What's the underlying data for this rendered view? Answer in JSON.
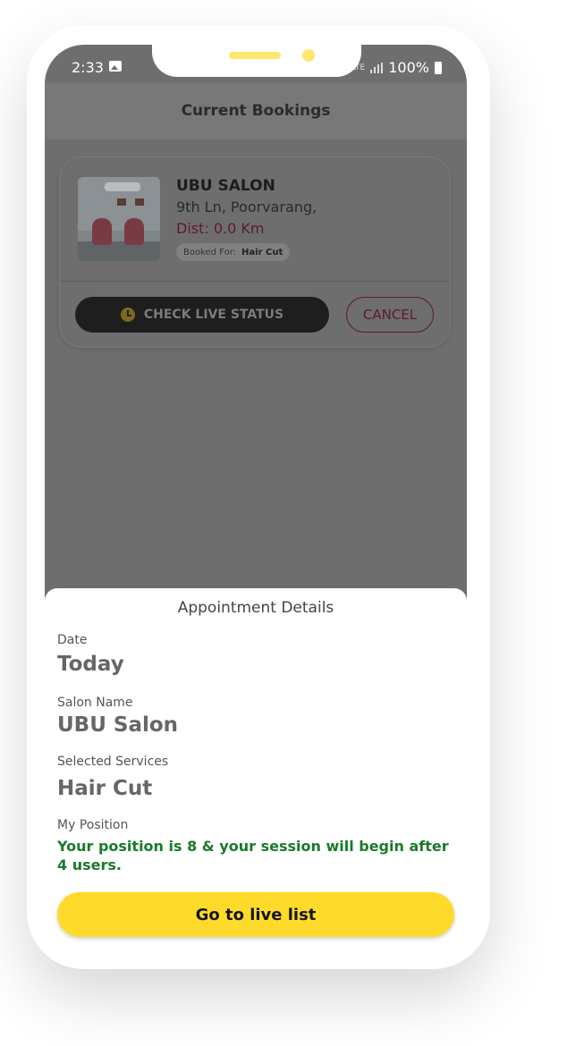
{
  "status_bar": {
    "time": "2:33",
    "network": "LTE",
    "battery": "100%"
  },
  "header": {
    "title": "Current Bookings"
  },
  "booking": {
    "salon_name": "UBU SALON",
    "address": "9th Ln, Poorvarang,",
    "distance": "Dist: 0.0 Km",
    "booked_for_label": "Booked For:",
    "booked_for_value": "Hair Cut",
    "live_status_label": "CHECK LIVE STATUS",
    "cancel_label": "CANCEL"
  },
  "sheet": {
    "title": "Appointment Details",
    "date_label": "Date",
    "date_value": "Today",
    "salon_label": "Salon Name",
    "salon_value": "UBU Salon",
    "services_label": "Selected Services",
    "services_value": "Hair Cut",
    "position_label": "My Position",
    "position_text": "Your position is 8 & your session will begin after 4 users.",
    "cta_label": "Go to live list"
  },
  "colors": {
    "accent_yellow": "#fedb2b",
    "position_green": "#1a7a2a",
    "cancel_red": "#c0243c"
  }
}
